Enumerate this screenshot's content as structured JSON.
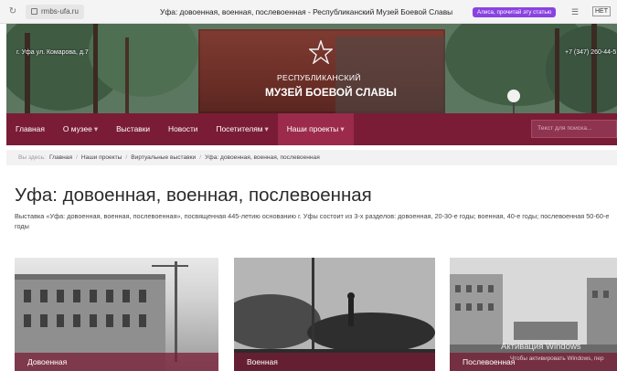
{
  "browser": {
    "url": "rmbs-ufa.ru",
    "tab_title": "Уфа: довоенная, военная, послевоенная - Республиканский Музей Боевой Славы",
    "alice_text": "Алиса, прочитай эту статью",
    "net_label": "НЕТ"
  },
  "hero": {
    "address": "г. Уфа ул. Комарова, д.7",
    "phone": "+7 (347) 260-44-5",
    "museum_top": "РЕСПУБЛИКАНСКИЙ",
    "museum_name": "МУЗЕЙ БОЕВОЙ СЛАВЫ"
  },
  "nav": {
    "items": [
      {
        "label": "Главная",
        "caret": ""
      },
      {
        "label": "О музее",
        "caret": "▾"
      },
      {
        "label": "Выставки",
        "caret": ""
      },
      {
        "label": "Новости",
        "caret": ""
      },
      {
        "label": "Посетителям",
        "caret": "▾"
      },
      {
        "label": "Наши проекты",
        "caret": "▾",
        "active": true
      }
    ],
    "search_placeholder": "Текст для поиска..."
  },
  "breadcrumb": {
    "prefix": "Вы здесь:",
    "items": [
      "Главная",
      "Наши проекты",
      "Виртуальные выставки",
      "Уфа: довоенная, военная, послевоенная"
    ],
    "separator": "/"
  },
  "page": {
    "title": "Уфа: довоенная, военная, послевоенная",
    "description": "Выставка «Уфа: довоенная, военная, послевоенная», посвященная 445-летию основанию г. Уфы состоит из 3-х разделов: довоенная, 20-30-е годы; военная, 40-е годы; послевоенная 50-60-е годы"
  },
  "cards": [
    {
      "label": "Довоенная"
    },
    {
      "label": "Военная"
    },
    {
      "label": "Послевоенная"
    }
  ],
  "os_watermark": {
    "line1": "Активация Windows",
    "line2": "Чтобы активировать Windows, пер"
  },
  "colors": {
    "nav_bg": "#7a1c36",
    "nav_active": "#9b2a4b",
    "alice": "#8a43e0"
  }
}
